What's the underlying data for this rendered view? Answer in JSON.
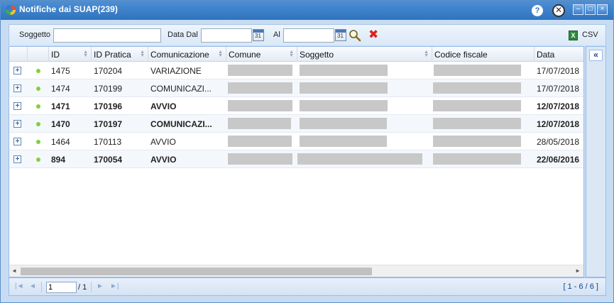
{
  "window": {
    "title": "Notifiche dai SUAP(239)",
    "help_label": "?",
    "close_circle_label": "✕",
    "min_label": "–",
    "max_label": "□",
    "close_label": "×"
  },
  "filters": {
    "subject_label": "Soggetto",
    "subject_value": "",
    "date_from_label": "Data Dal",
    "date_from_value": "",
    "date_to_label": "Al",
    "date_to_value": "",
    "csv_label": "CSV",
    "csv_icon_glyph": "X"
  },
  "grid": {
    "columns": [
      "ID",
      "ID Pratica",
      "Comunicazione",
      "Comune",
      "Soggetto",
      "Codice fiscale",
      "Data"
    ],
    "expand_glyph": "+",
    "rows": [
      {
        "id": "1475",
        "pratica": "170204",
        "comunicazione": "VARIAZIONE",
        "data": "17/07/2018",
        "bold": false
      },
      {
        "id": "1474",
        "pratica": "170199",
        "comunicazione": "COMUNICAZI...",
        "data": "17/07/2018",
        "bold": false
      },
      {
        "id": "1471",
        "pratica": "170196",
        "comunicazione": "AVVIO",
        "data": "12/07/2018",
        "bold": true
      },
      {
        "id": "1470",
        "pratica": "170197",
        "comunicazione": "COMUNICAZI...",
        "data": "12/07/2018",
        "bold": true
      },
      {
        "id": "1464",
        "pratica": "170113",
        "comunicazione": "AVVIO",
        "data": "28/05/2018",
        "bold": false
      },
      {
        "id": "894",
        "pratica": "170054",
        "comunicazione": "AVVIO",
        "data": "22/06/2016",
        "bold": true
      }
    ]
  },
  "side": {
    "collapse_label": "«"
  },
  "pager": {
    "first": "|◄",
    "prev": "◄",
    "next": "►",
    "last": "►|",
    "page_value": "1",
    "of_label": "/ 1",
    "count_label": "[ 1 - 6 / 6 ]"
  },
  "colors": {
    "titlebar": "#2f73bf",
    "status_dot": "#7fd13b",
    "clear": "#d9261c"
  }
}
